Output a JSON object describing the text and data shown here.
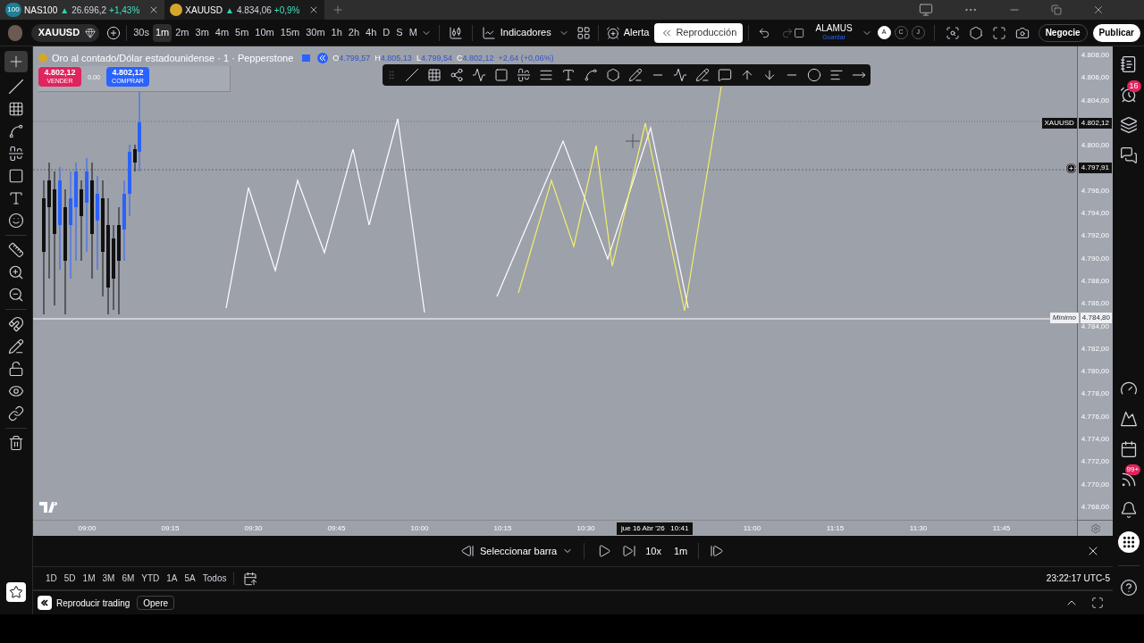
{
  "tabs": [
    {
      "symbol": "NAS100",
      "logo": "100",
      "arrow": "▲",
      "price": "26.696,2",
      "change": "+1,43%",
      "selected": false
    },
    {
      "symbol": "XAUUSD",
      "arrow": "▲",
      "price": "4.834,06",
      "change": "+0,9%",
      "selected": true
    }
  ],
  "toolbar": {
    "symbol": "XAUUSD",
    "intervals": [
      {
        "label": "30s",
        "selected": false
      },
      {
        "label": "1m",
        "selected": true
      },
      {
        "label": "2m",
        "selected": false
      },
      {
        "label": "3m",
        "selected": false
      },
      {
        "label": "4m",
        "selected": false
      },
      {
        "label": "5m",
        "selected": false
      },
      {
        "label": "10m",
        "selected": false
      },
      {
        "label": "15m",
        "selected": false
      },
      {
        "label": "30m",
        "selected": false
      },
      {
        "label": "1h",
        "selected": false
      },
      {
        "label": "2h",
        "selected": false
      },
      {
        "label": "4h",
        "selected": false
      },
      {
        "label": "D",
        "selected": false
      },
      {
        "label": "S",
        "selected": false
      },
      {
        "label": "M",
        "selected": false
      }
    ],
    "indicators": "Indicadores",
    "alert": "Alerta",
    "replay": "Reproducción",
    "layout_name": "ALAMUS",
    "layout_status": "Guardar",
    "circles": [
      {
        "label": "A",
        "selected": true
      },
      {
        "label": "C",
        "selected": false
      },
      {
        "label": "J",
        "selected": false
      }
    ],
    "trade": "Negocie",
    "publish": "Publicar"
  },
  "legend": {
    "title": "Oro al contado/Dólar estadounidense · 1 · Pepperstone",
    "ohlc": [
      {
        "key": "O",
        "value": "4.799,57"
      },
      {
        "key": "H",
        "value": "4.805,13"
      },
      {
        "key": "L",
        "value": "4.799,54"
      },
      {
        "key": "C",
        "value": "4.802,12"
      }
    ],
    "change": "+2,64 (+0,06%)"
  },
  "order": {
    "sell_price": "4.802,12",
    "sell_label": "VENDER",
    "spread": "0.00",
    "buy_price": "4.802,12",
    "buy_label": "COMPRAR"
  },
  "price_axis": {
    "rows": [
      {
        "kind": "tick",
        "value": "4.808,00"
      },
      {
        "kind": "tick",
        "value": "4.806,00"
      },
      {
        "kind": "tick",
        "value": "4.804,00"
      },
      {
        "kind": "last",
        "label": "XAUUSD",
        "value": "4.802,12"
      },
      {
        "kind": "tick",
        "value": "4.800,00"
      },
      {
        "kind": "crosshair",
        "value": "4.797,91"
      },
      {
        "kind": "tick",
        "value": "4.796,00"
      },
      {
        "kind": "tick",
        "value": "4.794,00"
      },
      {
        "kind": "tick",
        "value": "4.792,00"
      },
      {
        "kind": "tick",
        "value": "4.790,00"
      },
      {
        "kind": "tick",
        "value": "4.788,00"
      },
      {
        "kind": "tick",
        "value": "4.786,00"
      },
      {
        "kind": "tick",
        "value": "4.784,00"
      },
      {
        "kind": "tick",
        "value": "4.782,00"
      },
      {
        "kind": "tick",
        "value": "4.780,00"
      },
      {
        "kind": "tick",
        "value": "4.778,00"
      },
      {
        "kind": "tick",
        "value": "4.776,00"
      },
      {
        "kind": "tick",
        "value": "4.774,00"
      },
      {
        "kind": "tick",
        "value": "4.772,00"
      },
      {
        "kind": "tick",
        "value": "4.770,00"
      },
      {
        "kind": "tick",
        "value": "4.768,00"
      }
    ],
    "low_marker": {
      "label": "Mínimo",
      "value": "4.784,80"
    }
  },
  "time_axis": {
    "ticks_before": [
      "09:00",
      "09:15",
      "09:30",
      "09:45",
      "10:00",
      "10:15",
      "10:30"
    ],
    "cursor_date": "jue 16 Abr '26",
    "cursor_time": "10:41",
    "ticks_after": [
      "11:00",
      "11:15",
      "11:30",
      "11:45"
    ]
  },
  "replay_bar": {
    "select": "Seleccionar barra",
    "speed": "10x",
    "interval": "1m"
  },
  "ranges": [
    "1D",
    "5D",
    "1M",
    "3M",
    "6M",
    "YTD",
    "1A",
    "5A",
    "Todos"
  ],
  "clock": "23:22:17 UTC-5",
  "bottom_bar": {
    "replay_trading": "Reproducir trading",
    "trade": "Opere"
  },
  "sidebar_badges": {
    "alerts": "16",
    "feed": "99+"
  }
}
